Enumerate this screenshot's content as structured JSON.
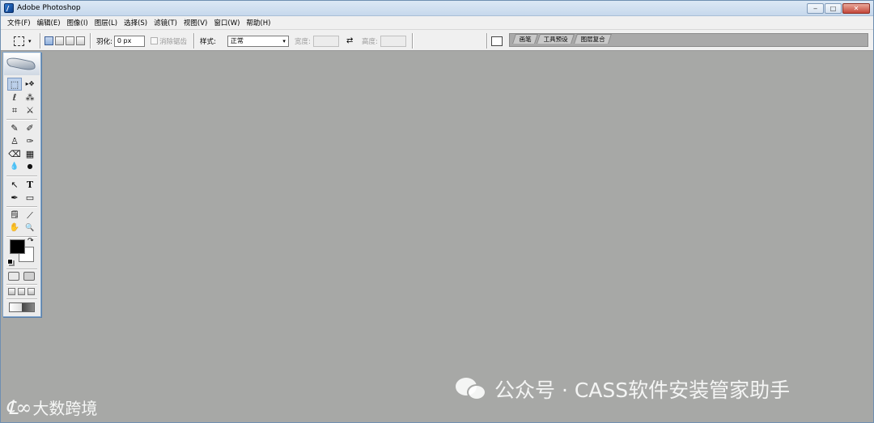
{
  "window": {
    "title": "Adobe Photoshop",
    "controls": {
      "minimize": "‒",
      "maximize": "□",
      "close": "✕"
    }
  },
  "menubar": {
    "items": [
      "文件(F)",
      "编辑(E)",
      "图像(I)",
      "图层(L)",
      "选择(S)",
      "滤镜(T)",
      "视图(V)",
      "窗口(W)",
      "帮助(H)"
    ]
  },
  "options": {
    "feather_label": "羽化:",
    "feather_value": "0 px",
    "antialias_label": "消除锯齿",
    "style_label": "样式:",
    "style_value": "正常",
    "width_label": "宽度:",
    "height_label": "高度:",
    "swap_icon": "⇄"
  },
  "palette_well": {
    "tabs": [
      "画笔",
      "工具预设",
      "图层复合"
    ]
  },
  "toolbox": {
    "icons": {
      "rect-marquee": "⬚",
      "move": "▸✥",
      "lasso": "ℓ",
      "magic-wand": "⁂",
      "crop": "⌗",
      "slice": "⚔",
      "healing": "✎",
      "brush": "✐",
      "stamp": "♙",
      "history-brush": "✑",
      "eraser": "⌫",
      "gradient": "▦",
      "blur": "💧",
      "dodge": "●",
      "path-select": "↖",
      "type": "T",
      "pen": "✒",
      "shape": "▭",
      "notes": "🗒",
      "eyedropper": "⟋",
      "hand": "✋",
      "zoom": "🔍",
      "swap": "↷"
    }
  },
  "colors": {
    "foreground": "#000000",
    "background": "#ffffff",
    "workspace": "#a7a8a6"
  },
  "watermarks": {
    "right": "公众号 · CASS软件安装管家助手",
    "left_mark": "℄∞",
    "left_text": "大数跨境"
  }
}
